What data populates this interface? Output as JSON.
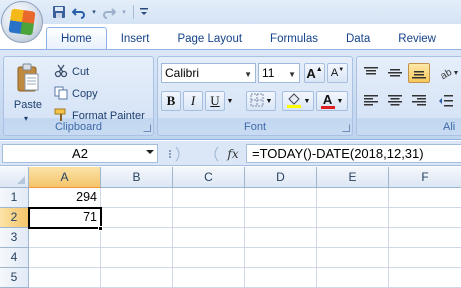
{
  "qat": {
    "save_icon": "save-icon",
    "undo_icon": "undo-icon",
    "redo_icon": "redo-icon",
    "customize_icon": "customize-qat-icon"
  },
  "tabs": [
    {
      "label": "Home",
      "active": true
    },
    {
      "label": "Insert"
    },
    {
      "label": "Page Layout"
    },
    {
      "label": "Formulas"
    },
    {
      "label": "Data"
    },
    {
      "label": "Review"
    }
  ],
  "clipboard": {
    "paste_label": "Paste",
    "cut_label": "Cut",
    "copy_label": "Copy",
    "format_painter_label": "Format Painter",
    "group_label": "Clipboard"
  },
  "font": {
    "family_value": "Calibri",
    "size_value": "11",
    "bold": "B",
    "italic": "I",
    "underline": "U",
    "grow_label": "A",
    "shrink_label": "A",
    "font_color_label": "A",
    "group_label": "Font",
    "fill_color": "#ffff00",
    "font_color": "#e02020"
  },
  "alignment": {
    "group_label": "Ali"
  },
  "formula_bar": {
    "name_box": "A2",
    "fx_label": "fx",
    "formula": "=TODAY()-DATE(2018,12,31)"
  },
  "grid": {
    "columns": [
      "A",
      "B",
      "C",
      "D",
      "E",
      "F"
    ],
    "rows": [
      "1",
      "2",
      "3",
      "4",
      "5"
    ],
    "cells": {
      "A1": "294",
      "A2": "71"
    },
    "active_cell": "A2"
  },
  "colors": {
    "accent": "#15428b",
    "selection_header": "#f4c46a"
  }
}
